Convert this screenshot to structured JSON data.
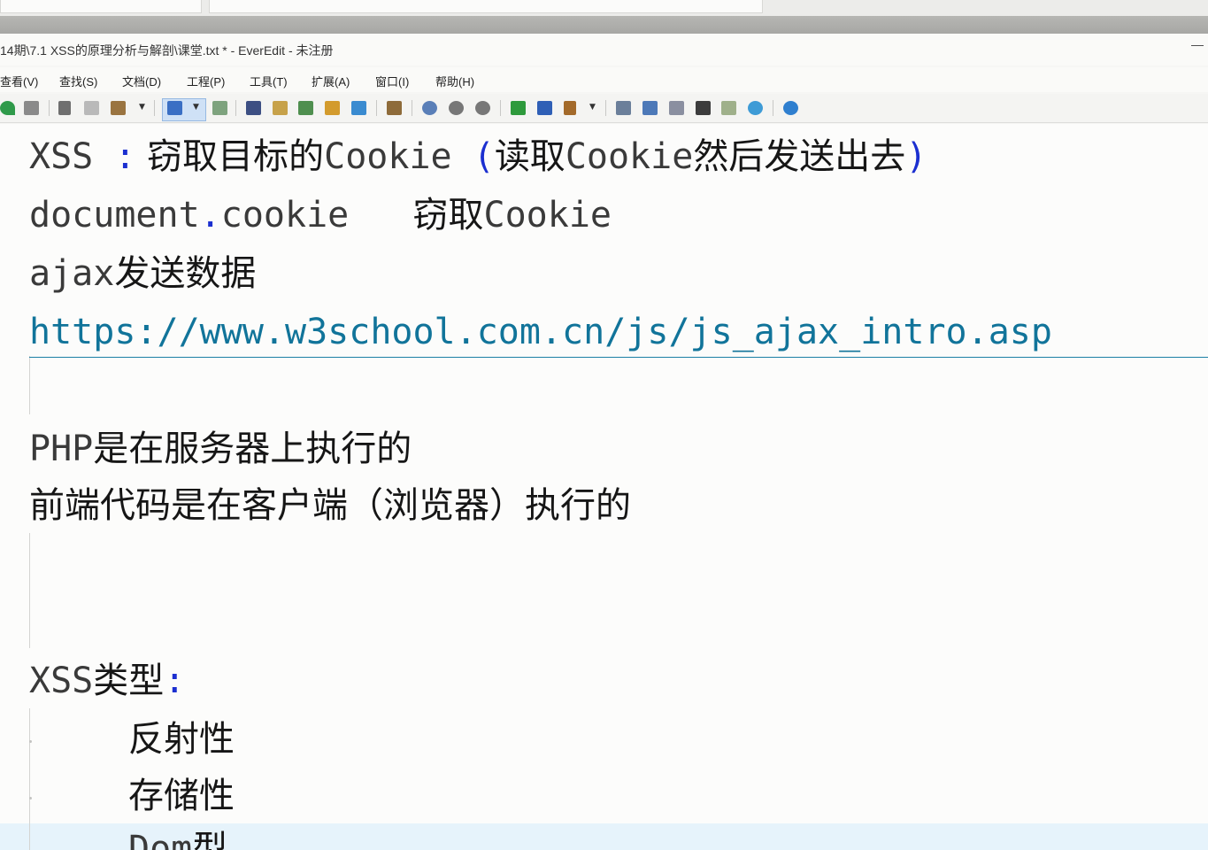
{
  "window": {
    "title": "14期\\7.1 XSS的原理分析与解剖\\课堂.txt * - EverEdit - 未注册",
    "minimize": "—"
  },
  "menubar": {
    "items": [
      "查看(V)",
      "查找(S)",
      "文档(D)",
      "工程(P)",
      "工具(T)",
      "扩展(A)",
      "窗口(I)",
      "帮助(H)"
    ]
  },
  "toolbar": {
    "icons": [
      "redo-icon",
      "replace-icon",
      "cut-icon",
      "copy-icon",
      "paste-icon",
      "wrap-icon",
      "view-icon",
      "find-icon",
      "edit-icon",
      "tools-icon",
      "preview-icon",
      "tree-icon",
      "compare-icon",
      "macro-icon",
      "macro2-icon",
      "macro3-icon",
      "run-icon",
      "stop-icon",
      "build-icon",
      "panel-icon",
      "split-icon",
      "doc-icon",
      "console-icon",
      "chart-icon",
      "browser-icon",
      "chat-icon"
    ]
  },
  "editor": {
    "lines": {
      "l1_a": "XSS ",
      "l1_colon": ":",
      "l1_b": " 窃取目标的",
      "l1_c": "Cookie ",
      "l1_paren_open": "(",
      "l1_d": "读取",
      "l1_e": "Cookie",
      "l1_f": "然后发送出去",
      "l1_paren_close": ")",
      "l2_a": "document",
      "l2_dot": ".",
      "l2_b": "cookie   ",
      "l2_c": "窃取",
      "l2_d": "Cookie",
      "l3_a": "ajax",
      "l3_b": "发送数据",
      "l4_url": "https://www.w3school.com.cn/js/js_ajax_intro.asp",
      "l5_a": "PHP",
      "l5_b": "是在服务器上执行的",
      "l6": "前端代码是在客户端（浏览器）执行的",
      "l7_a": "XSS",
      "l7_b": "类型",
      "l7_colon": ":",
      "l8": "反射性",
      "l9": "存储性",
      "l10_a": "Dom",
      "l10_b": "型"
    }
  }
}
